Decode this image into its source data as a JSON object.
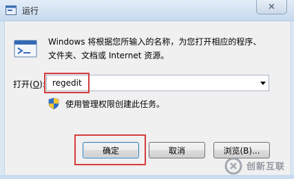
{
  "window": {
    "title": "运行",
    "close_glyph": "✕"
  },
  "icons": {
    "app": "run-app-icon",
    "run": "run-icon",
    "shield": "uac-shield-icon",
    "close": "close-icon",
    "dropdown": "chevron-down-icon",
    "watermark_logo": "chuangxin-logo"
  },
  "dialog": {
    "description_line1": "Windows 将根据您所输入的名称，为您打开相应的程序、",
    "description_line2": "文件夹、文档或 Internet 资源。",
    "open_label_prefix": "打开(",
    "open_label_key": "O",
    "open_label_suffix": "):",
    "open_value": "regedit",
    "admin_note": "使用管理权限创建此任务。"
  },
  "buttons": {
    "ok": "确定",
    "cancel": "取消",
    "browse": "浏览(B)..."
  },
  "watermark": {
    "text": "创新互联"
  },
  "colors": {
    "highlight_box": "#d43b3b",
    "window_bg": "#f0f0f0",
    "titlebar": "#c7d9ee"
  }
}
